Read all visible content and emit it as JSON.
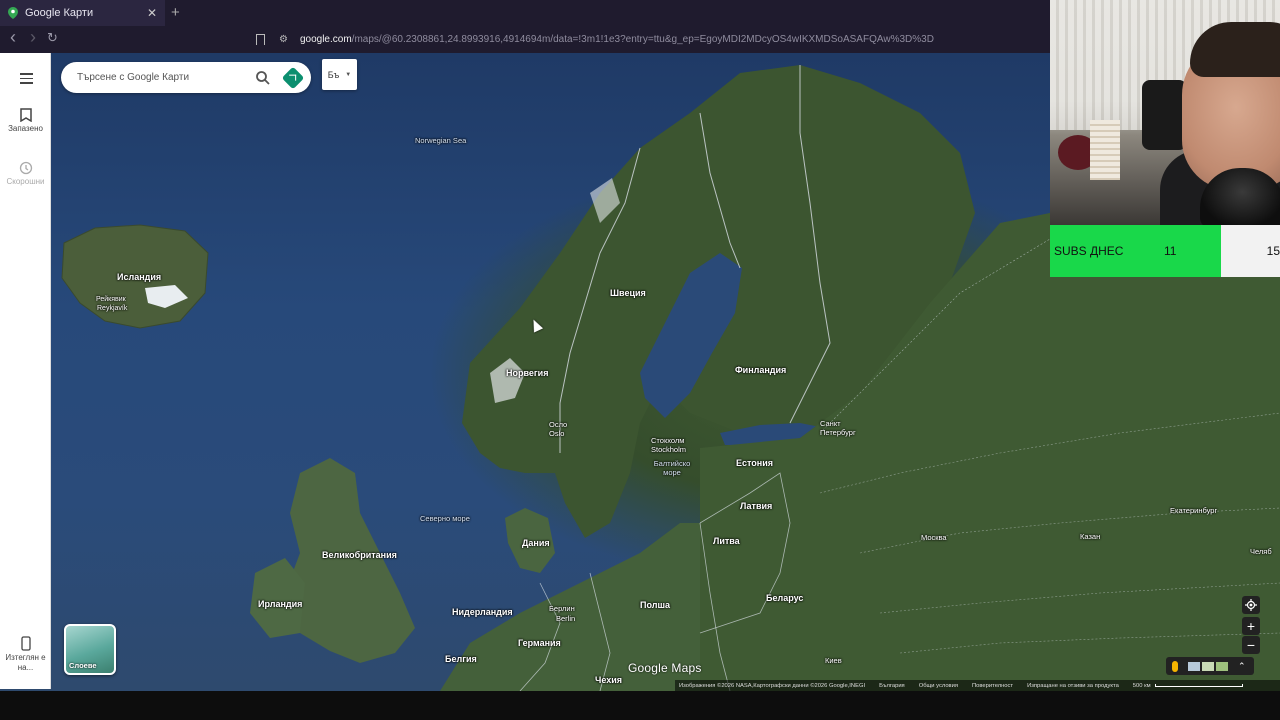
{
  "browser": {
    "tab_title": "Google Карти",
    "tab_close": "✕",
    "new_tab": "+",
    "back": "‹",
    "forward": "›",
    "reload": "↻",
    "url_host": "google.com",
    "url_rest": "/maps/@60.2308861,24.8993916,4914694m/data=!3m1!1e3?entry=ttu&g_ep=EgoyMDI2MDcyOS4wIKXMDSoASAFQAw%3D%3D"
  },
  "rail": {
    "saved": "Запазено",
    "recent": "Скорошни",
    "download": "Изтеглян е на..."
  },
  "search": {
    "placeholder": "Търсене с Google Карти",
    "lang_button": "Бъ"
  },
  "layers": {
    "label": "Слоеве"
  },
  "map": {
    "labels": {
      "norwegian_sea": "Norwegian Sea",
      "iceland": "Исландия",
      "reykjavik": "Рейкявик",
      "reykjavik_latin": "Reykjavík",
      "sweden": "Швеция",
      "norway": "Норвегия",
      "finland": "Финландия",
      "oslo": "Осло",
      "oslo_latin": "Oslo",
      "stockholm": "Стокхолм",
      "stockholm_latin": "Stockholm",
      "baltic_sea": "Балтийско море",
      "st_petersburg": "Санкт Петербург",
      "estonia": "Естония",
      "latvia": "Латвия",
      "lithuania": "Литва",
      "north_sea": "Северно море",
      "denmark": "Дания",
      "uk": "Великобритания",
      "ireland": "Ирландия",
      "netherlands": "Нидерландия",
      "berlin": "Берлин",
      "berlin_latin": "Berlin",
      "poland": "Полша",
      "belarus": "Беларус",
      "germany": "Германия",
      "belgium": "Белгия",
      "czechia": "Чехия",
      "kyiv": "Киев",
      "moscow": "Москва",
      "kazan": "Казан",
      "yekaterinburg": "Екатеринбург",
      "chelyabinsk": "Челяб"
    },
    "watermark": "Google Maps",
    "footer": {
      "attribution": "Изображения ©2026 NASA,Картографски данни ©2026 Google,INEGI",
      "country": "България",
      "terms": "Общи условия",
      "privacy": "Поверителност",
      "feedback": "Изпращане на отзиви за продукта",
      "scale": "500 км"
    }
  },
  "overlay": {
    "subs_label": "SUBS ДНЕС",
    "subs_today": "11",
    "subs_goal": "15"
  }
}
